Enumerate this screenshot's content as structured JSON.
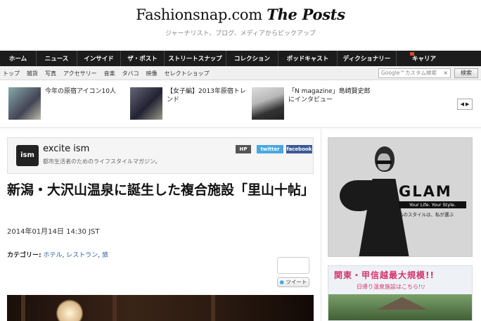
{
  "header": {
    "logo_main": "Fashionsnap.com",
    "logo_posts": "The Posts",
    "tagline": "ジャーナリスト、ブログ、メディアからピックアップ"
  },
  "main_nav": [
    "ホーム",
    "ニュース",
    "インサイド",
    "ザ・ポスト",
    "ストリートスナップ",
    "コレクション",
    "ポッドキャスト",
    "ディクショナリー",
    "キャリア"
  ],
  "sub_nav": [
    "トップ",
    "雑貨",
    "写真",
    "アクセサリー",
    "音楽",
    "タバコ",
    "映像",
    "セレクトショップ"
  ],
  "search": {
    "placeholder": "Google™カスタム検索",
    "clear": "×",
    "button": "検索"
  },
  "features": [
    {
      "text": "今年の原宿アイコン10人"
    },
    {
      "text": "【女子編】2013年原宿トレンド"
    },
    {
      "text": "「N magazine」島崎賢史郎にインタビュー"
    }
  ],
  "feature_nav": {
    "prev": "◀",
    "next": "▶"
  },
  "source": {
    "logo": "ism",
    "name": "excite ism",
    "description": "都市生活者のためのライフスタイルマガジン。",
    "badge_hp": "HP",
    "badge_twitter": "twitter",
    "badge_facebook": "facebook"
  },
  "article": {
    "title": "新潟・大沢山温泉に誕生した複合施設「里山十帖」",
    "date": "2014年01月14日 14:30 JST",
    "category_label": "カテゴリー:",
    "categories": [
      "ホテル",
      "レストラン",
      "旅"
    ],
    "tweet": "ツイート"
  },
  "ads": {
    "glam_title": "GLAM",
    "glam_tagline": "Your Life. Your Style.",
    "glam_sub": "私のスタイルは、私が選ぶ",
    "onsen_title": "関東・甲信越最大規模!!",
    "onsen_sub": "日帰り温泉施設はこちら!▽"
  },
  "colors": {
    "nav_bg": "#1c1c1c",
    "link": "#2a5d9f",
    "twitter": "#48a8e0",
    "facebook": "#3b5998",
    "onsen_pink": "#d6336c"
  }
}
